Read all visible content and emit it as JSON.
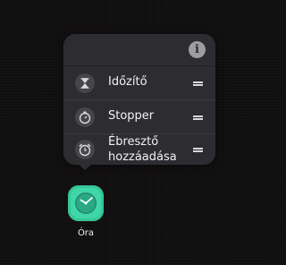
{
  "shortcut_menu": {
    "info_icon": "info-icon",
    "items": [
      {
        "label": "Időzítő",
        "icon": "hourglass-icon"
      },
      {
        "label": "Stopper",
        "icon": "stopwatch-icon"
      },
      {
        "label_line1": "Ébresztő",
        "label_line2": "hozzáadása",
        "icon": "alarm-clock-icon"
      }
    ]
  },
  "app": {
    "label": "Óra",
    "icon": "clock-icon",
    "color": "#40d6a7"
  }
}
